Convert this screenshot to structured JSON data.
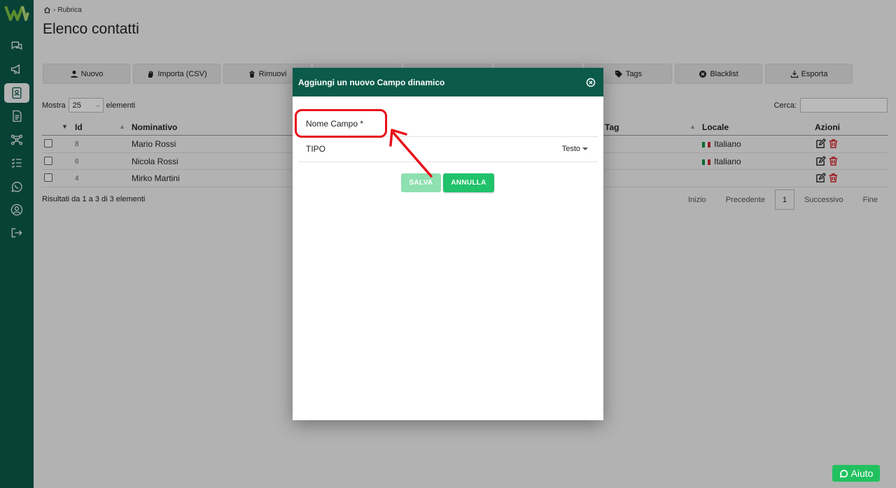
{
  "breadcrumb": {
    "label": "Rubrica"
  },
  "page": {
    "title": "Elenco contatti"
  },
  "toolbar": {
    "buttons": [
      {
        "label": "Nuovo",
        "icon": "user-plus-icon"
      },
      {
        "label": "Importa (CSV)",
        "icon": "hand-icon"
      },
      {
        "label": "Rimuovi",
        "icon": "trash-icon"
      },
      {
        "label": "",
        "icon": ""
      },
      {
        "label": "",
        "icon": ""
      },
      {
        "label": "",
        "icon": ""
      },
      {
        "label": "Tags",
        "icon": "tag-icon"
      },
      {
        "label": "Blacklist",
        "icon": "ban-icon"
      },
      {
        "label": "Esporta",
        "icon": "export-icon"
      }
    ]
  },
  "length": {
    "prefix": "Mostra",
    "value": "25",
    "suffix": "elementi"
  },
  "search": {
    "label": "Cerca:",
    "value": ""
  },
  "table": {
    "headers": {
      "id": "Id",
      "name": "Nominativo",
      "tag": "Tag",
      "locale": "Locale",
      "actions": "Azioni"
    },
    "rows": [
      {
        "id": "8",
        "name": "Mario Rossi",
        "locale": "Italiano"
      },
      {
        "id": "6",
        "name": "Nicola Rossi",
        "locale": "Italiano"
      },
      {
        "id": "4",
        "name": "Mirko Martini",
        "locale": ""
      }
    ]
  },
  "results": {
    "text": "Risultati da 1 a 3 di 3 elementi"
  },
  "pager": {
    "first": "Inizio",
    "prev": "Precedente",
    "current": "1",
    "next": "Successivo",
    "last": "Fine"
  },
  "modal": {
    "title": "Aggiungi un nuovo Campo dinamico",
    "name_label": "Nome Campo *",
    "type_label": "TIPO",
    "type_value": "Testo",
    "save_label": "SALVA",
    "cancel_label": "ANNULLA"
  },
  "help": {
    "label": "Aiuto"
  },
  "colors": {
    "brand": "#0b5a4a",
    "accent": "#22c160",
    "highlight": "#e8101a"
  }
}
